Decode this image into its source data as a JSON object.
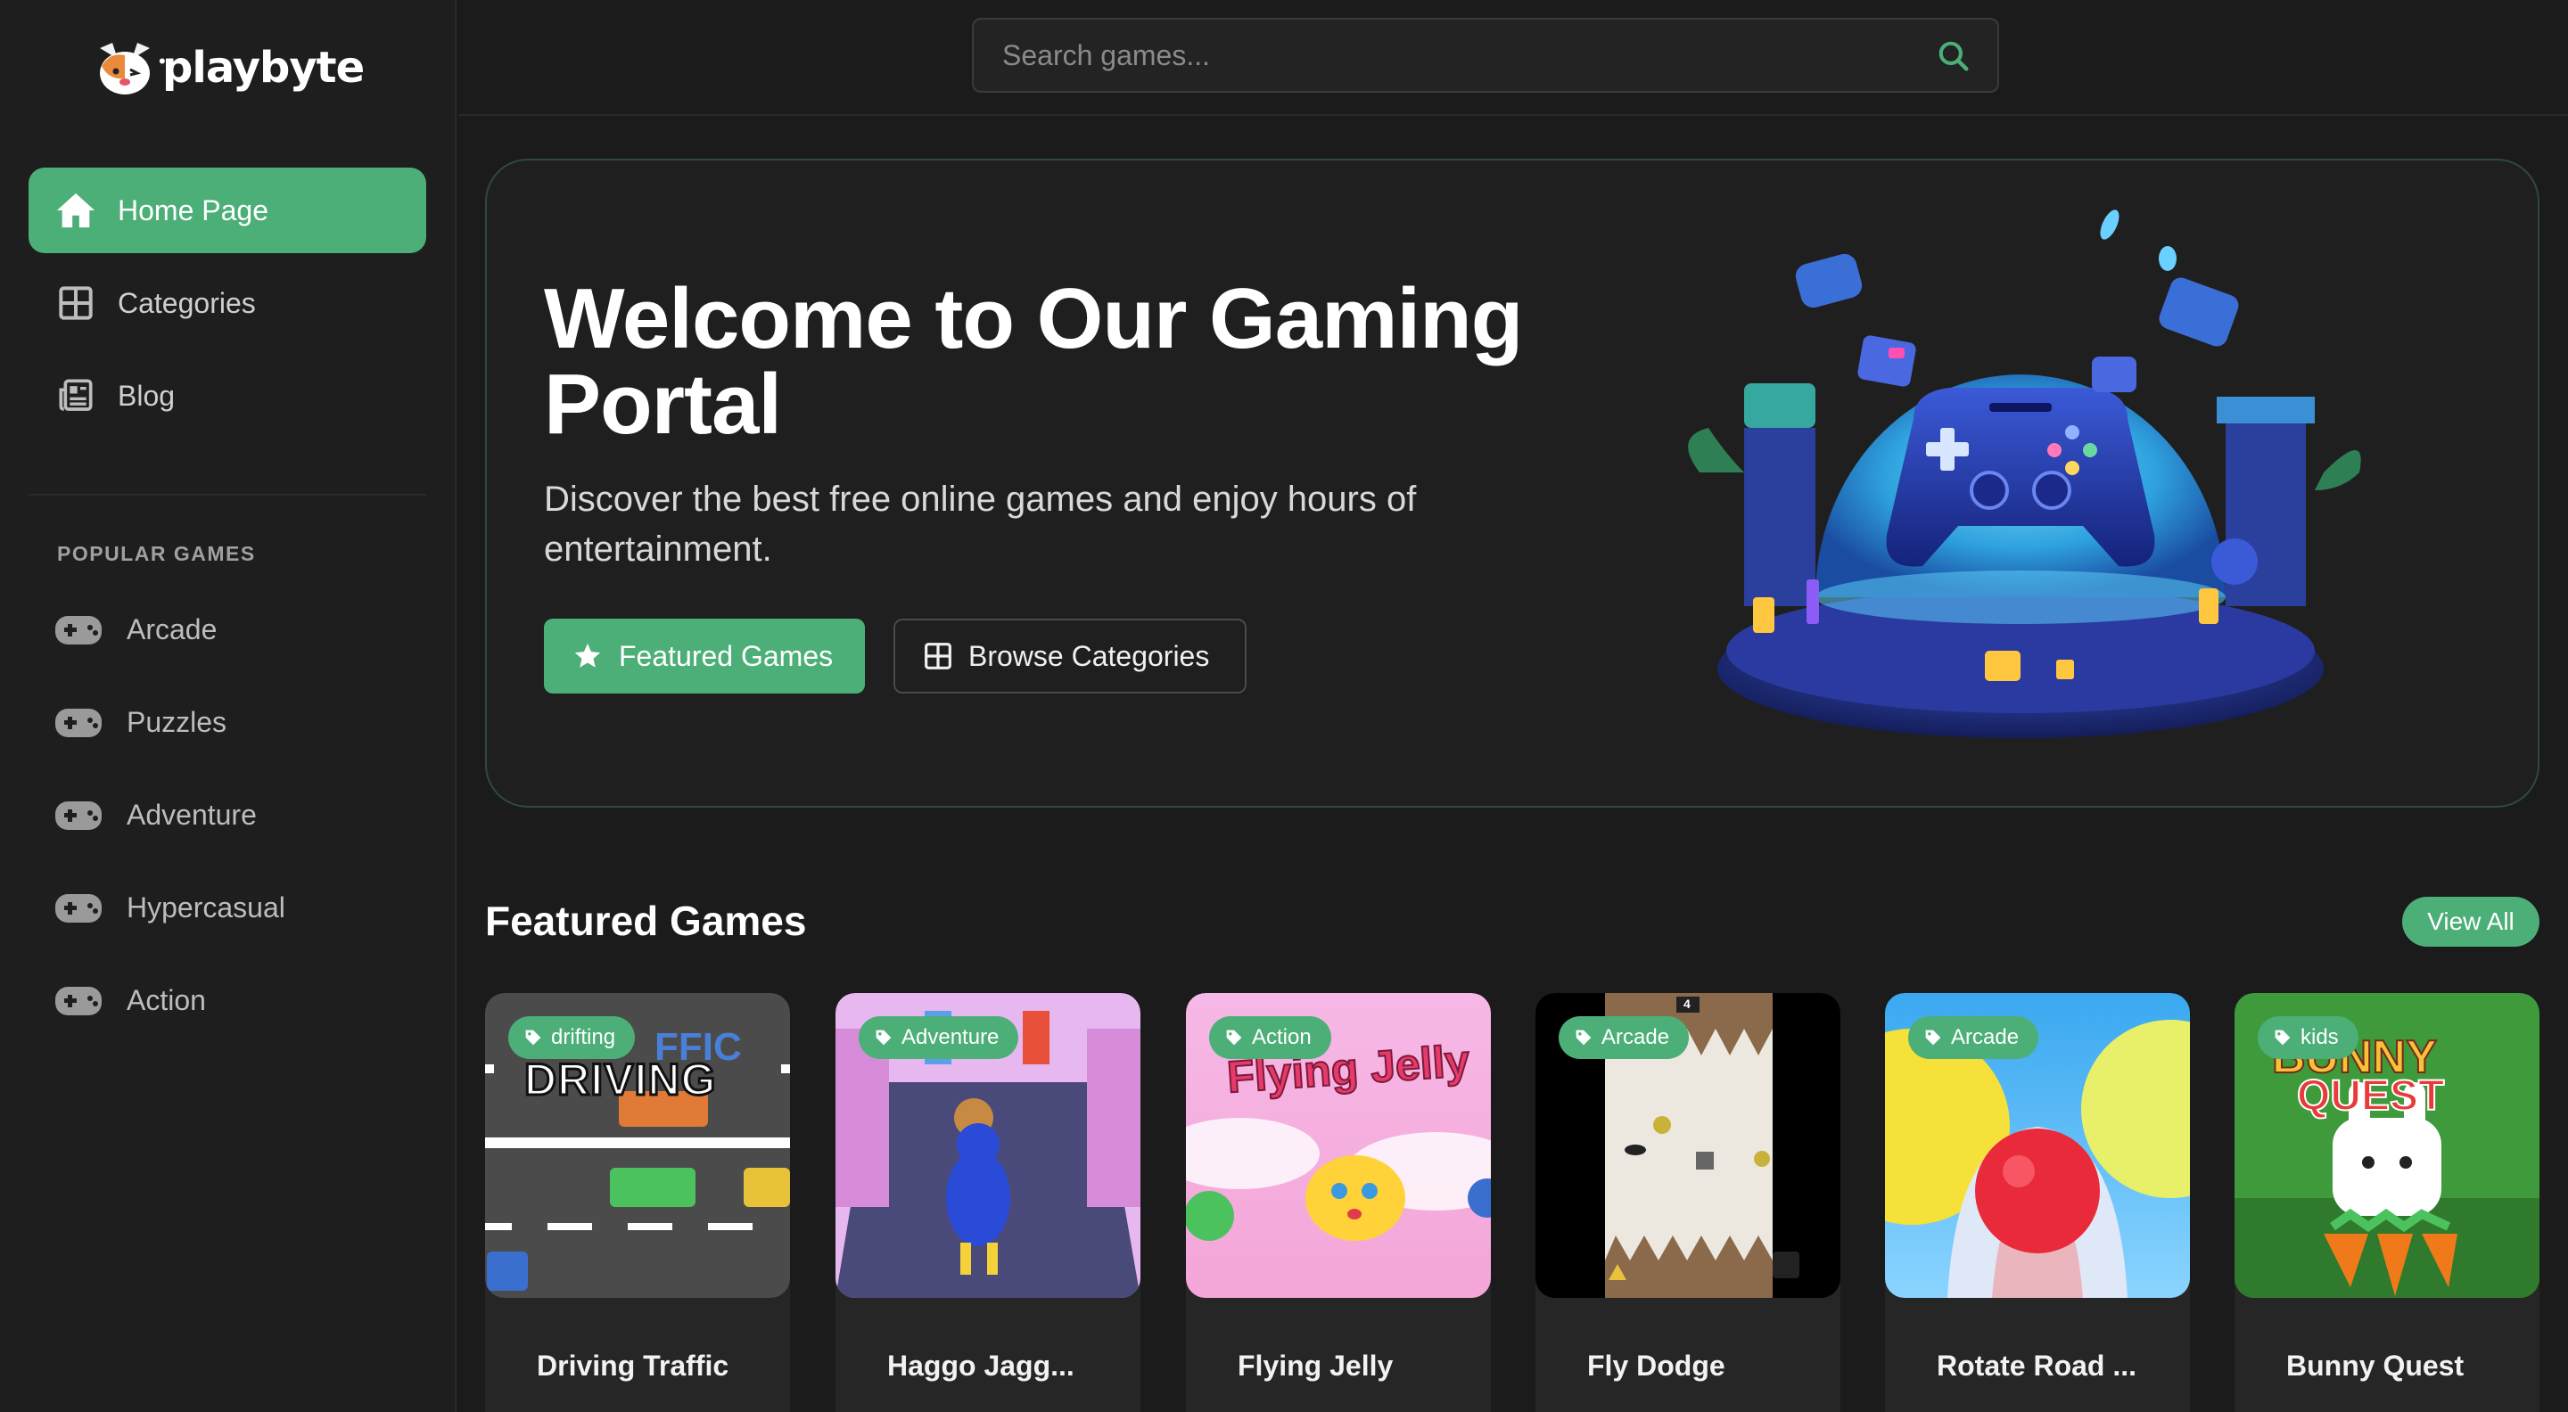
{
  "brand": {
    "name": "playbyte",
    "dots": "•••"
  },
  "search": {
    "placeholder": "Search games..."
  },
  "nav": [
    {
      "label": "Home Page",
      "icon": "home-icon",
      "active": true
    },
    {
      "label": "Categories",
      "icon": "grid-icon",
      "active": false
    },
    {
      "label": "Blog",
      "icon": "newspaper-icon",
      "active": false
    }
  ],
  "popular": {
    "title": "POPULAR GAMES",
    "items": [
      "Arcade",
      "Puzzles",
      "Adventure",
      "Hypercasual",
      "Action"
    ]
  },
  "hero": {
    "title": "Welcome to Our Gaming Portal",
    "subtitle": "Discover the best free online games and enjoy hours of entertainment.",
    "primary_button": "Featured Games",
    "secondary_button": "Browse Categories"
  },
  "featured": {
    "title": "Featured Games",
    "view_all": "View All",
    "games": [
      {
        "tag": "drifting",
        "title": "Driving Traffic"
      },
      {
        "tag": "Adventure",
        "title": "Haggo Jagg..."
      },
      {
        "tag": "Action",
        "title": "Flying Jelly"
      },
      {
        "tag": "Arcade",
        "title": "Fly Dodge"
      },
      {
        "tag": "Arcade",
        "title": "Rotate Road ..."
      },
      {
        "tag": "kids",
        "title": "Bunny Quest"
      }
    ],
    "thumb_text": {
      "driving_top": "FFIC",
      "driving_main": "DRIVING",
      "jelly": "Flying Jelly",
      "dodge_score": "4",
      "bunny_1": "BUNNY",
      "bunny_2": "QUEST"
    }
  },
  "colors": {
    "accent": "#4caf78",
    "background": "#1b1b1b",
    "sidebar": "#1e1e1e"
  }
}
